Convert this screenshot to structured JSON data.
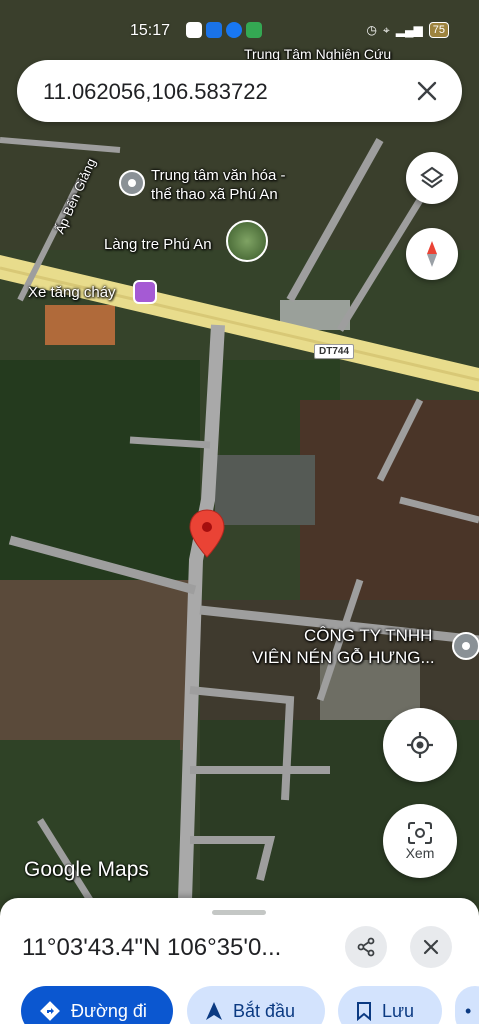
{
  "status_bar": {
    "time": "15:17",
    "battery": "75"
  },
  "search": {
    "query": "11.062056,106.583722"
  },
  "map": {
    "labels": {
      "research_center": "Trung Tâm Nghiên Cứu",
      "culture_center_line1": "Trung tâm văn hóa -",
      "culture_center_line2": "thể thao xã Phú An",
      "bamboo_village": "Làng tre Phú An",
      "hamlet": "Ấp Bến Giảng",
      "tank": "Xe tăng cháy",
      "company_line1": "CÔNG TY TNHH",
      "company_line2": "VIÊN NÉN GỖ HƯNG..."
    },
    "road_shield": "DT744",
    "attribution": "Google Maps",
    "pin_color": "#ea4335"
  },
  "controls": {
    "layers_icon": "layers-icon",
    "compass_icon": "compass-icon",
    "location_icon": "my-location-icon",
    "view_label": "Xem"
  },
  "sheet": {
    "coords": "11°03'43.4\"N 106°35'0...",
    "actions": {
      "directions": "Đường đi",
      "start": "Bắt đầu",
      "save": "Lưu"
    }
  },
  "colors": {
    "accent": "#0b57d0",
    "chip_secondary": "#d3e3fd"
  }
}
